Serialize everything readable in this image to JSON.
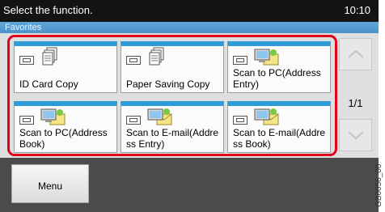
{
  "header": {
    "title": "Select the function.",
    "time": "10:10"
  },
  "section": {
    "label": "Favorites"
  },
  "buttons": [
    {
      "label": "ID Card Copy",
      "icon": "copy-icon"
    },
    {
      "label": "Paper Saving Copy",
      "icon": "copy-icon"
    },
    {
      "label": "Scan to PC(Address Entry)",
      "icon": "scan-to-pc-icon"
    },
    {
      "label": "Scan to PC(Address Book)",
      "icon": "scan-to-pc-icon"
    },
    {
      "label": "Scan to E-mail(Address Entry)",
      "icon": "scan-to-email-icon"
    },
    {
      "label": "Scan to E-mail(Address Book)",
      "icon": "scan-to-email-icon"
    }
  ],
  "pager": {
    "text": "1/1"
  },
  "footer": {
    "menu_label": "Menu"
  },
  "figure_code": "GB0056_00",
  "colors": {
    "accent": "#2d9bd7",
    "highlight": "#e0001a",
    "header": "#141414"
  }
}
